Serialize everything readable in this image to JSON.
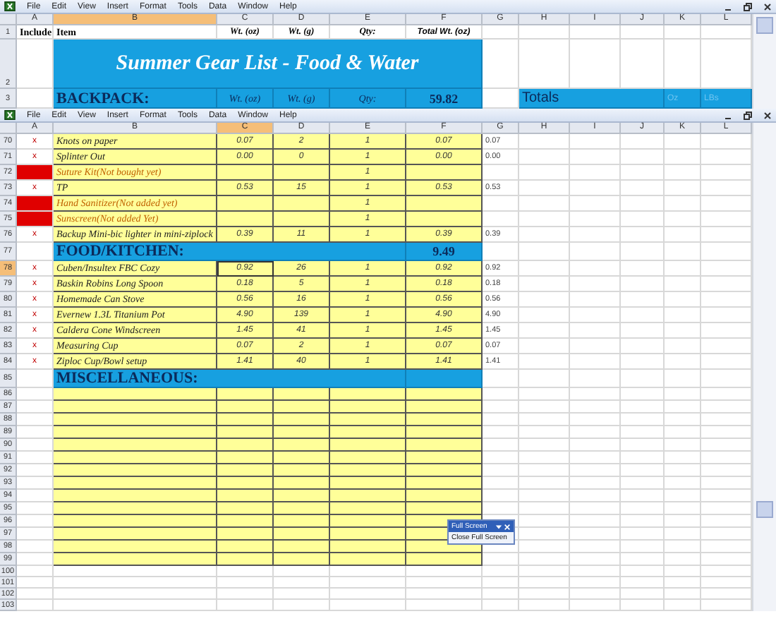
{
  "top_window": {
    "menus": [
      "File",
      "Edit",
      "View",
      "Insert",
      "Format",
      "Tools",
      "Data",
      "Window",
      "Help"
    ],
    "columns": [
      {
        "label": "A",
        "selected": false
      },
      {
        "label": "B",
        "selected": true
      },
      {
        "label": "C",
        "selected": false
      },
      {
        "label": "D",
        "selected": false
      },
      {
        "label": "E",
        "selected": false
      },
      {
        "label": "F",
        "selected": false
      },
      {
        "label": "G",
        "selected": false
      },
      {
        "label": "H",
        "selected": false
      },
      {
        "label": "I",
        "selected": false
      },
      {
        "label": "J",
        "selected": false
      },
      {
        "label": "K",
        "selected": false
      },
      {
        "label": "L",
        "selected": false
      }
    ],
    "header_row": {
      "row": "1",
      "include": "Include",
      "item": "Item",
      "wt_oz": "Wt. (oz)",
      "wt_g": "Wt. (g)",
      "qty": "Qty:",
      "total": "Total Wt. (oz)"
    },
    "title_row": {
      "row": "2",
      "title": "Summer Gear List - Food & Water"
    },
    "backpack_row": {
      "row": "3",
      "label": "BACKPACK:",
      "wt_oz": "Wt. (oz)",
      "wt_g": "Wt. (g)",
      "qty": "Qty:",
      "total": "59.82",
      "totals": "Totals",
      "oz": "Oz",
      "lbs": "LBs"
    }
  },
  "bottom_window": {
    "menus": [
      "File",
      "Edit",
      "View",
      "Insert",
      "Format",
      "Tools",
      "Data",
      "Window",
      "Help"
    ],
    "columns": [
      {
        "label": "A",
        "selected": false
      },
      {
        "label": "B",
        "selected": false
      },
      {
        "label": "C",
        "selected": true
      },
      {
        "label": "D",
        "selected": false
      },
      {
        "label": "E",
        "selected": false
      },
      {
        "label": "F",
        "selected": false
      },
      {
        "label": "G",
        "selected": false
      },
      {
        "label": "H",
        "selected": false
      },
      {
        "label": "I",
        "selected": false
      },
      {
        "label": "J",
        "selected": false
      },
      {
        "label": "K",
        "selected": false
      },
      {
        "label": "L",
        "selected": false
      }
    ],
    "rows": [
      {
        "kind": "item",
        "row": "70",
        "selected": false,
        "missing": false,
        "include": "x",
        "name": "Knots on paper",
        "wt_oz": "0.07",
        "wt_g": "2",
        "qty": "1",
        "total": "0.07",
        "g": "0.07"
      },
      {
        "kind": "item",
        "row": "71",
        "selected": false,
        "missing": false,
        "include": "x",
        "name": "Splinter Out",
        "wt_oz": "0.00",
        "wt_g": "0",
        "qty": "1",
        "total": "0.00",
        "g": "0.00"
      },
      {
        "kind": "item",
        "row": "72",
        "selected": false,
        "missing": true,
        "name": "Suture Kit(Not bought yet)",
        "qty": "1"
      },
      {
        "kind": "item",
        "row": "73",
        "selected": false,
        "missing": false,
        "include": "x",
        "name": "TP",
        "wt_oz": "0.53",
        "wt_g": "15",
        "qty": "1",
        "total": "0.53",
        "g": "0.53"
      },
      {
        "kind": "item",
        "row": "74",
        "selected": false,
        "missing": true,
        "name": "Hand Sanitizer(Not added yet)",
        "qty": "1"
      },
      {
        "kind": "item",
        "row": "75",
        "selected": false,
        "missing": true,
        "name": "Sunscreen(Not added Yet)",
        "qty": "1"
      },
      {
        "kind": "item",
        "row": "76",
        "selected": false,
        "missing": false,
        "include": "x",
        "name": "Backup Mini-bic lighter in mini-ziplock",
        "wt_oz": "0.39",
        "wt_g": "11",
        "qty": "1",
        "total": "0.39",
        "g": "0.39"
      },
      {
        "kind": "section",
        "row": "77",
        "selected": false,
        "name": "FOOD/KITCHEN:",
        "total": "9.49"
      },
      {
        "kind": "item",
        "row": "78",
        "selected": true,
        "missing": false,
        "include": "x",
        "name": "Cuben/Insultex FBC Cozy",
        "wt_oz": "0.92",
        "wt_g": "26",
        "qty": "1",
        "total": "0.92",
        "g": "0.92"
      },
      {
        "kind": "item",
        "row": "79",
        "selected": false,
        "missing": false,
        "include": "x",
        "name": "Baskin Robins Long Spoon",
        "wt_oz": "0.18",
        "wt_g": "5",
        "qty": "1",
        "total": "0.18",
        "g": "0.18"
      },
      {
        "kind": "item",
        "row": "80",
        "selected": false,
        "missing": false,
        "include": "x",
        "name": "Homemade Can Stove",
        "wt_oz": "0.56",
        "wt_g": "16",
        "qty": "1",
        "total": "0.56",
        "g": "0.56"
      },
      {
        "kind": "item",
        "row": "81",
        "selected": false,
        "missing": false,
        "include": "x",
        "name": "Evernew 1.3L Titanium Pot",
        "wt_oz": "4.90",
        "wt_g": "139",
        "qty": "1",
        "total": "4.90",
        "g": "4.90"
      },
      {
        "kind": "item",
        "row": "82",
        "selected": false,
        "missing": false,
        "include": "x",
        "name": "Caldera Cone Windscreen",
        "wt_oz": "1.45",
        "wt_g": "41",
        "qty": "1",
        "total": "1.45",
        "g": "1.45"
      },
      {
        "kind": "item",
        "row": "83",
        "selected": false,
        "missing": false,
        "include": "x",
        "name": "Measuring Cup",
        "wt_oz": "0.07",
        "wt_g": "2",
        "qty": "1",
        "total": "0.07",
        "g": "0.07"
      },
      {
        "kind": "item",
        "row": "84",
        "selected": false,
        "missing": false,
        "include": "x",
        "name": "Ziploc Cup/Bowl setup",
        "wt_oz": "1.41",
        "wt_g": "40",
        "qty": "1",
        "total": "1.41",
        "g": "1.41"
      },
      {
        "kind": "section",
        "row": "85",
        "selected": false,
        "name": "MISCELLANEOUS:"
      },
      {
        "kind": "entry",
        "row": "86",
        "selected": false
      },
      {
        "kind": "entry",
        "row": "87",
        "selected": false
      },
      {
        "kind": "entry",
        "row": "88",
        "selected": false
      },
      {
        "kind": "entry",
        "row": "89",
        "selected": false
      },
      {
        "kind": "entry",
        "row": "90",
        "selected": false
      },
      {
        "kind": "entry",
        "row": "91",
        "selected": false
      },
      {
        "kind": "entry",
        "row": "92",
        "selected": false
      },
      {
        "kind": "entry",
        "row": "93",
        "selected": false
      },
      {
        "kind": "entry",
        "row": "94",
        "selected": false
      },
      {
        "kind": "entry",
        "row": "95",
        "selected": false
      },
      {
        "kind": "entry",
        "row": "96",
        "selected": false
      },
      {
        "kind": "entry",
        "row": "97",
        "selected": false
      },
      {
        "kind": "entry",
        "row": "98",
        "selected": false
      },
      {
        "kind": "entry",
        "row": "99",
        "selected": false
      },
      {
        "kind": "plain",
        "row": "100",
        "selected": false
      },
      {
        "kind": "plain",
        "row": "101",
        "selected": false
      },
      {
        "kind": "plain",
        "row": "102",
        "selected": false
      },
      {
        "kind": "plain",
        "row": "103",
        "selected": false
      }
    ]
  },
  "full_screen_toolbar": {
    "title": "Full Screen",
    "button": "Close Full Screen"
  }
}
